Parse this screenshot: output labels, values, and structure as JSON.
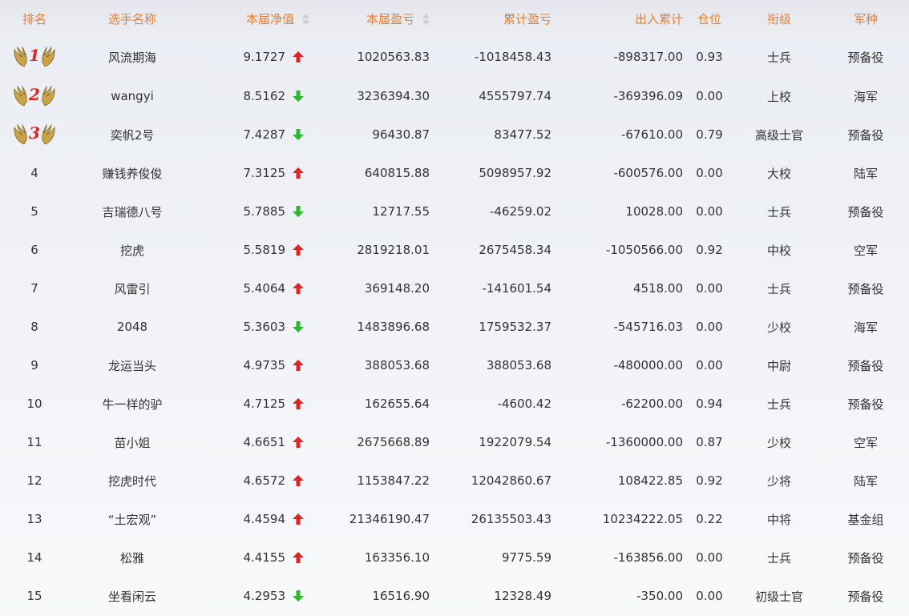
{
  "colors": {
    "header_text": "#e8803a",
    "up_arrow": "#e02424",
    "down_arrow": "#2eb82e",
    "badge_gold": "#c9a24a",
    "rank_number": "#e02424"
  },
  "headers": {
    "rank": "排名",
    "player": "选手名称",
    "nav": "本届净值",
    "pnl": "本届盈亏",
    "cum_pnl": "累计盈亏",
    "flow": "出入累计",
    "position": "仓位",
    "grade": "衔级",
    "branch": "军种"
  },
  "icons": {
    "sort": "sort-icon",
    "up": "arrow-up-icon",
    "down": "arrow-down-icon",
    "badge": "laurel-wings-icon"
  },
  "rows": [
    {
      "rank": "1",
      "name": "风流期海",
      "nav": "9.1727",
      "trend": "up",
      "pnl": "1020563.83",
      "cum": "-1018458.43",
      "flow": "-898317.00",
      "pos": "0.93",
      "grade": "士兵",
      "branch": "预备役"
    },
    {
      "rank": "2",
      "name": "wangyi",
      "nav": "8.5162",
      "trend": "down",
      "pnl": "3236394.30",
      "cum": "4555797.74",
      "flow": "-369396.09",
      "pos": "0.00",
      "grade": "上校",
      "branch": "海军"
    },
    {
      "rank": "3",
      "name": "奕帆2号",
      "nav": "7.4287",
      "trend": "down",
      "pnl": "96430.87",
      "cum": "83477.52",
      "flow": "-67610.00",
      "pos": "0.79",
      "grade": "高级士官",
      "branch": "预备役"
    },
    {
      "rank": "4",
      "name": "赚钱养俊俊",
      "nav": "7.3125",
      "trend": "up",
      "pnl": "640815.88",
      "cum": "5098957.92",
      "flow": "-600576.00",
      "pos": "0.00",
      "grade": "大校",
      "branch": "陆军"
    },
    {
      "rank": "5",
      "name": "吉瑞德八号",
      "nav": "5.7885",
      "trend": "down",
      "pnl": "12717.55",
      "cum": "-46259.02",
      "flow": "10028.00",
      "pos": "0.00",
      "grade": "士兵",
      "branch": "预备役"
    },
    {
      "rank": "6",
      "name": "挖虎",
      "nav": "5.5819",
      "trend": "up",
      "pnl": "2819218.01",
      "cum": "2675458.34",
      "flow": "-1050566.00",
      "pos": "0.92",
      "grade": "中校",
      "branch": "空军"
    },
    {
      "rank": "7",
      "name": "风雷引",
      "nav": "5.4064",
      "trend": "up",
      "pnl": "369148.20",
      "cum": "-141601.54",
      "flow": "4518.00",
      "pos": "0.00",
      "grade": "士兵",
      "branch": "预备役"
    },
    {
      "rank": "8",
      "name": "2048",
      "nav": "5.3603",
      "trend": "down",
      "pnl": "1483896.68",
      "cum": "1759532.37",
      "flow": "-545716.03",
      "pos": "0.00",
      "grade": "少校",
      "branch": "海军"
    },
    {
      "rank": "9",
      "name": "龙运当头",
      "nav": "4.9735",
      "trend": "up",
      "pnl": "388053.68",
      "cum": "388053.68",
      "flow": "-480000.00",
      "pos": "0.00",
      "grade": "中尉",
      "branch": "预备役"
    },
    {
      "rank": "10",
      "name": "牛一样的驴",
      "nav": "4.7125",
      "trend": "up",
      "pnl": "162655.64",
      "cum": "-4600.42",
      "flow": "-62200.00",
      "pos": "0.94",
      "grade": "士兵",
      "branch": "预备役"
    },
    {
      "rank": "11",
      "name": "苗小姐",
      "nav": "4.6651",
      "trend": "up",
      "pnl": "2675668.89",
      "cum": "1922079.54",
      "flow": "-1360000.00",
      "pos": "0.87",
      "grade": "少校",
      "branch": "空军"
    },
    {
      "rank": "12",
      "name": "挖虎时代",
      "nav": "4.6572",
      "trend": "up",
      "pnl": "1153847.22",
      "cum": "12042860.67",
      "flow": "108422.85",
      "pos": "0.92",
      "grade": "少将",
      "branch": "陆军"
    },
    {
      "rank": "13",
      "name": "“土宏观”",
      "nav": "4.4594",
      "trend": "up",
      "pnl": "21346190.47",
      "cum": "26135503.43",
      "flow": "10234222.05",
      "pos": "0.22",
      "grade": "中将",
      "branch": "基金组"
    },
    {
      "rank": "14",
      "name": "松雅",
      "nav": "4.4155",
      "trend": "up",
      "pnl": "163356.10",
      "cum": "9775.59",
      "flow": "-163856.00",
      "pos": "0.00",
      "grade": "士兵",
      "branch": "预备役"
    },
    {
      "rank": "15",
      "name": "坐看闲云",
      "nav": "4.2953",
      "trend": "down",
      "pnl": "16516.90",
      "cum": "12328.49",
      "flow": "-350.00",
      "pos": "0.00",
      "grade": "初级士官",
      "branch": "预备役"
    }
  ]
}
